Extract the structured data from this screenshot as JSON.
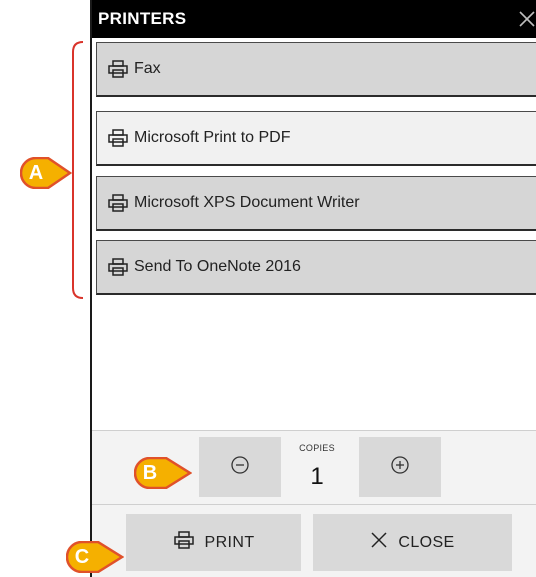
{
  "dialog": {
    "title": "PRINTERS"
  },
  "printers": [
    {
      "label": "Fax",
      "selected": false
    },
    {
      "label": "Microsoft Print to PDF",
      "selected": true
    },
    {
      "label": "Microsoft XPS Document Writer",
      "selected": false
    },
    {
      "label": "Send To OneNote 2016",
      "selected": false
    }
  ],
  "copies": {
    "label": "COPIES",
    "value": "1",
    "decrement_icon": "minus-circle-icon",
    "increment_icon": "plus-circle-icon"
  },
  "actions": {
    "print_label": "PRINT",
    "close_label": "CLOSE"
  },
  "annotations": {
    "a": "A",
    "b": "B",
    "c": "C",
    "marker_color": "#f5b000",
    "marker_inner": "#e0512a",
    "bracket_color": "#d9342b"
  }
}
